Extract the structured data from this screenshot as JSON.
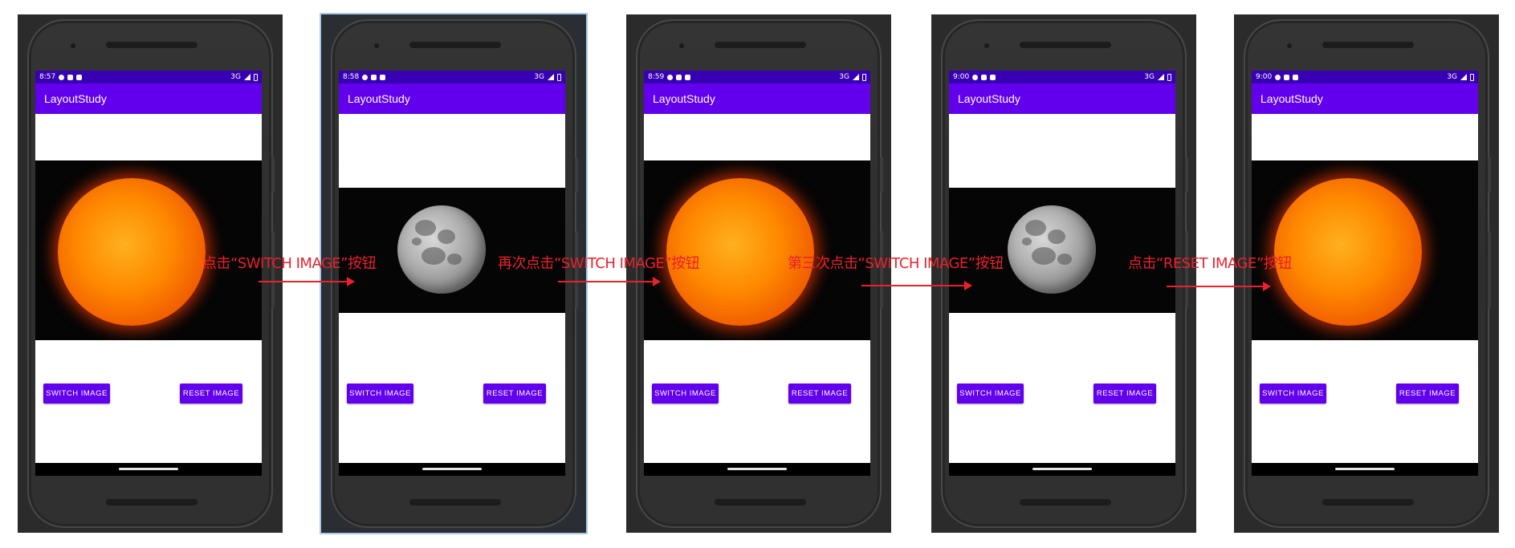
{
  "colors": {
    "status_bar": "#3700b3",
    "app_bar": "#6200ee",
    "button": "#6200ee",
    "annotation": "#e8212a"
  },
  "app_title": "LayoutStudy",
  "buttons": {
    "switch_label": "SWITCH IMAGE",
    "reset_label": "RESET IMAGE"
  },
  "status": {
    "network": "3G"
  },
  "screens": [
    {
      "time": "8:57",
      "image": "sun-image"
    },
    {
      "time": "8:58",
      "image": "moon-image"
    },
    {
      "time": "8:59",
      "image": "sun-image"
    },
    {
      "time": "9:00",
      "image": "moon-image"
    },
    {
      "time": "9:00",
      "image": "sun-image"
    }
  ],
  "steps": [
    "点击“SWITCH IMAGE”按钮",
    "再次点击“SWITCH IMAGE”按钮",
    "第三次点击“SWITCH IMAGE”按钮",
    "点击“RESET IMAGE”按钮"
  ]
}
